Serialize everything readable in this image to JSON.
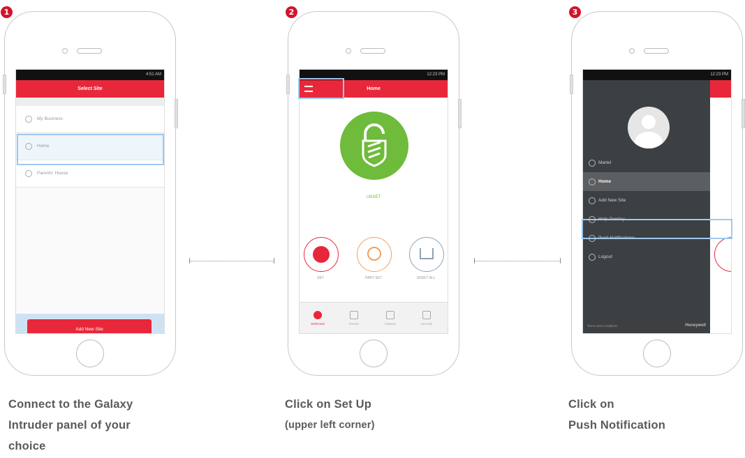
{
  "steps": [
    {
      "number": "1",
      "caption_lines": [
        "Connect to the Galaxy",
        "Intruder panel of your",
        "choice"
      ],
      "screen": {
        "status_text": "4:51 AM",
        "title": "Select Site",
        "sites": [
          "My Business",
          "Home",
          "Parents' House"
        ],
        "selected_site": "Home",
        "add_button": "Add New Site"
      }
    },
    {
      "number": "2",
      "caption_lines": [
        "Click on Set Up"
      ],
      "caption_sub": "(upper left corner)",
      "screen": {
        "status_text": "12:23 PM",
        "title": "Home",
        "state": "UNSET",
        "modes": [
          "SET",
          "PART SET",
          "UNSET ALL"
        ],
        "tabs": [
          "Set/Unset",
          "Events",
          "Outputs",
          "Security"
        ]
      }
    },
    {
      "number": "3",
      "caption_lines": [
        "Click on",
        "Push Notification"
      ],
      "screen": {
        "status_text": "12:23 PM",
        "menu": [
          "Martel",
          "Home",
          "Add New Site",
          "Help Overlay",
          "Push Notifications",
          "Logout"
        ],
        "active_item": "Home",
        "highlighted_item": "Push Notifications",
        "footer_left": "Terms and Conditions",
        "footer_brand": "Honeywell"
      }
    }
  ],
  "colors": {
    "accent": "#e8283a",
    "badge": "#d0152c",
    "highlight": "#9fc9ef",
    "unset_green": "#6fbb3b"
  }
}
